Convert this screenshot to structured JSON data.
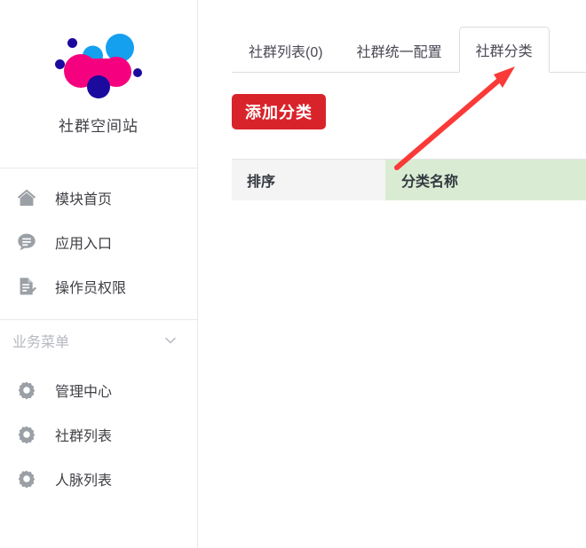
{
  "sidebar": {
    "brand": {
      "name": "社群空间站",
      "logo_icon": "community-logo-icon",
      "logo_colors": {
        "cyan": "#14a0ef",
        "magenta": "#f5007f",
        "navy": "#1a0a9e"
      }
    },
    "top_items": [
      {
        "label": "模块首页",
        "icon": "home-icon"
      },
      {
        "label": "应用入口",
        "icon": "chat-bubble-icon"
      },
      {
        "label": "操作员权限",
        "icon": "document-edit-icon"
      }
    ],
    "section": {
      "title": "业务菜单",
      "chevron_icon": "chevron-down-icon"
    },
    "business_items": [
      {
        "label": "管理中心",
        "icon": "gear-icon"
      },
      {
        "label": "社群列表",
        "icon": "gear-icon"
      },
      {
        "label": "人脉列表",
        "icon": "gear-icon"
      }
    ]
  },
  "main": {
    "tabs": [
      {
        "label": "社群列表(0)",
        "active": false
      },
      {
        "label": "社群统一配置",
        "active": false
      },
      {
        "label": "社群分类",
        "active": true
      }
    ],
    "add_button": {
      "label": "添加分类",
      "color": "#d9232b"
    },
    "table": {
      "columns": [
        {
          "label": "排序",
          "background": "#f4f4f4"
        },
        {
          "label": "分类名称",
          "background": "#d9ecd3"
        }
      ],
      "rows": []
    }
  },
  "annotation": {
    "arrow_icon": "arrow-pointer-icon",
    "color": "#f93a38",
    "points_to": "社群分类"
  }
}
